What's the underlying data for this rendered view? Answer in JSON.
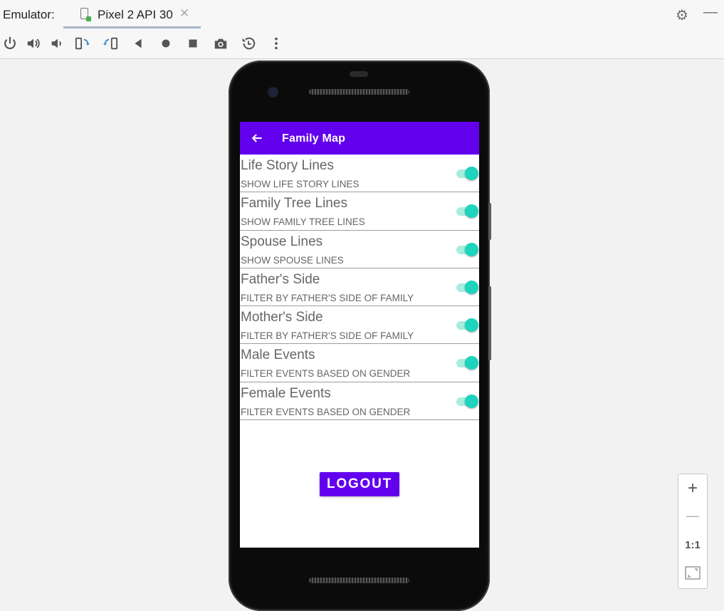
{
  "window": {
    "label": "Emulator:",
    "tab_title": "Pixel 2 API 30",
    "tab_close": "✕",
    "settings_glyph": "⚙",
    "minimize_glyph": "—"
  },
  "toolbar": {
    "items": [
      "power-icon",
      "volume-up-icon",
      "volume-down-icon",
      "rotate-left-icon",
      "rotate-right-icon",
      "back-icon",
      "home-icon",
      "overview-icon",
      "screenshot-icon",
      "snapshot-icon",
      "more-icon"
    ]
  },
  "app": {
    "title": "Family Map",
    "back_glyph": "←",
    "accent": "#6200ee",
    "switch_color": "#1ed4bd",
    "settings": [
      {
        "title": "Life Story Lines",
        "subtitle": "SHOW LIFE STORY LINES",
        "on": true
      },
      {
        "title": "Family Tree Lines",
        "subtitle": "SHOW FAMILY TREE LINES",
        "on": true
      },
      {
        "title": "Spouse Lines",
        "subtitle": "SHOW SPOUSE LINES",
        "on": true
      },
      {
        "title": "Father's Side",
        "subtitle": "FILTER BY FATHER'S SIDE OF FAMILY",
        "on": true
      },
      {
        "title": "Mother's Side",
        "subtitle": "FILTER BY FATHER'S SIDE OF FAMILY",
        "on": true
      },
      {
        "title": "Male Events",
        "subtitle": "FILTER EVENTS BASED ON GENDER",
        "on": true
      },
      {
        "title": "Female Events",
        "subtitle": "FILTER EVENTS BASED ON GENDER",
        "on": true
      }
    ],
    "logout_label": "LOGOUT"
  },
  "zoom": {
    "zoom_in": "+",
    "zoom_out": "—",
    "actual_size": "1:1"
  }
}
